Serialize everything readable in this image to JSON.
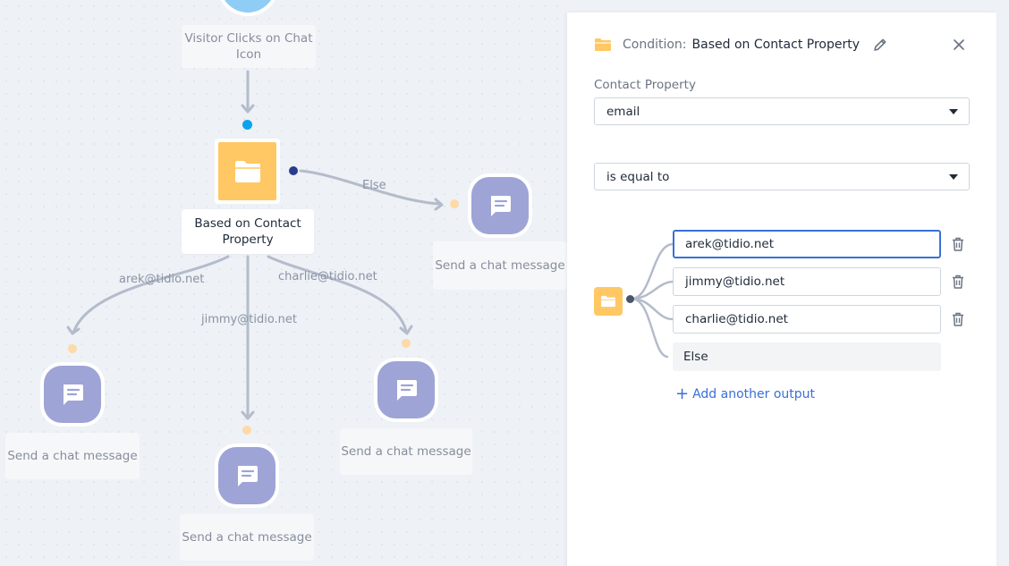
{
  "canvas": {
    "trigger_label": "Visitor Clicks on Chat Icon",
    "condition_label": "Based on Contact Property",
    "edges": {
      "else": "Else",
      "arek": "arek@tidio.net",
      "jimmy": "jimmy@tidio.net",
      "charlie": "charlie@tidio.net"
    },
    "action_label": "Send a chat message"
  },
  "panel": {
    "title_prefix": "Condition:",
    "title": "Based on Contact Property",
    "property_label": "Contact Property",
    "property_value": "email",
    "operator_value": "is equal to",
    "outputs": [
      "arek@tidio.net",
      "jimmy@tidio.net",
      "charlie@tidio.net"
    ],
    "else_label": "Else",
    "add_output_label": "Add another output"
  },
  "colors": {
    "accent": "#3a6fd8",
    "folder": "#ffc864",
    "bubble": "#9ea4d6",
    "trigger": "#8fcdf5"
  },
  "icons": [
    "folder-icon",
    "chat-icon",
    "pencil-icon",
    "close-icon",
    "trash-icon",
    "plus-icon",
    "caret-down-icon"
  ]
}
